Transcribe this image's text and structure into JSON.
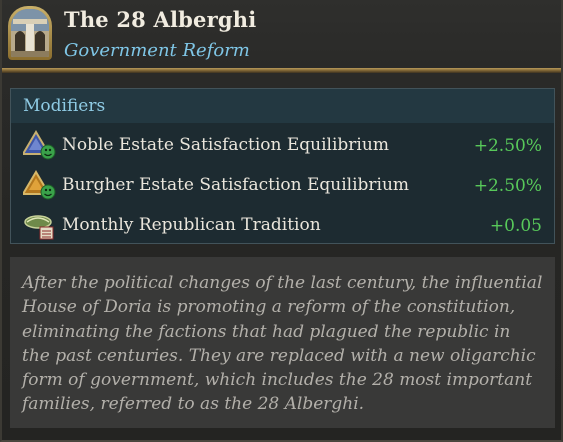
{
  "header": {
    "title": "The 28 Alberghi",
    "subtitle": "Government Reform",
    "portrait_icon": "palazzo-courtyard-icon"
  },
  "modifiers": {
    "heading": "Modifiers",
    "items": [
      {
        "icon": "noble-estate-satisfaction-icon",
        "label": "Noble Estate Satisfaction Equilibrium",
        "value": "+2.50%"
      },
      {
        "icon": "burgher-estate-satisfaction-icon",
        "label": "Burgher Estate Satisfaction Equilibrium",
        "value": "+2.50%"
      },
      {
        "icon": "republican-tradition-icon",
        "label": "Monthly Republican Tradition",
        "value": "+0.05"
      }
    ]
  },
  "description": "After the political changes of the last century, the influential House of Doria is promoting a reform of the constitution, eliminating the factions that had plagued the republic in the past centuries. They are replaced with a new oligarchic form of government, which includes the 28 most important families, referred to as the 28 Alberghi.",
  "colors": {
    "title": "#f1ece0",
    "subtitle": "#7fc6e6",
    "positive_value": "#58c95a",
    "gold_rule": "#b99a5a"
  }
}
